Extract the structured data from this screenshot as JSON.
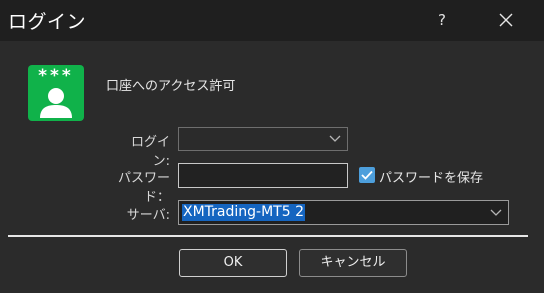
{
  "window": {
    "title": "ログイン",
    "help_label": "?"
  },
  "header": {
    "icon_stars": "***",
    "message": "口座へのアクセス許可"
  },
  "form": {
    "login_label": "ログイン:",
    "login_value": "",
    "password_label": "パスワード：",
    "password_value": "",
    "save_password_label": "パスワードを保存",
    "save_password_checked": true,
    "server_label": "サーバ:",
    "server_value": "XMTrading-MT5 2"
  },
  "buttons": {
    "ok_label": "OK",
    "cancel_label": "キャンセル"
  },
  "colors": {
    "background": "#2b2b2b",
    "titlebar": "#1f1f1f",
    "icon_green": "#10b24a",
    "selection": "#1565c0",
    "checkbox": "#4d9fdc"
  }
}
